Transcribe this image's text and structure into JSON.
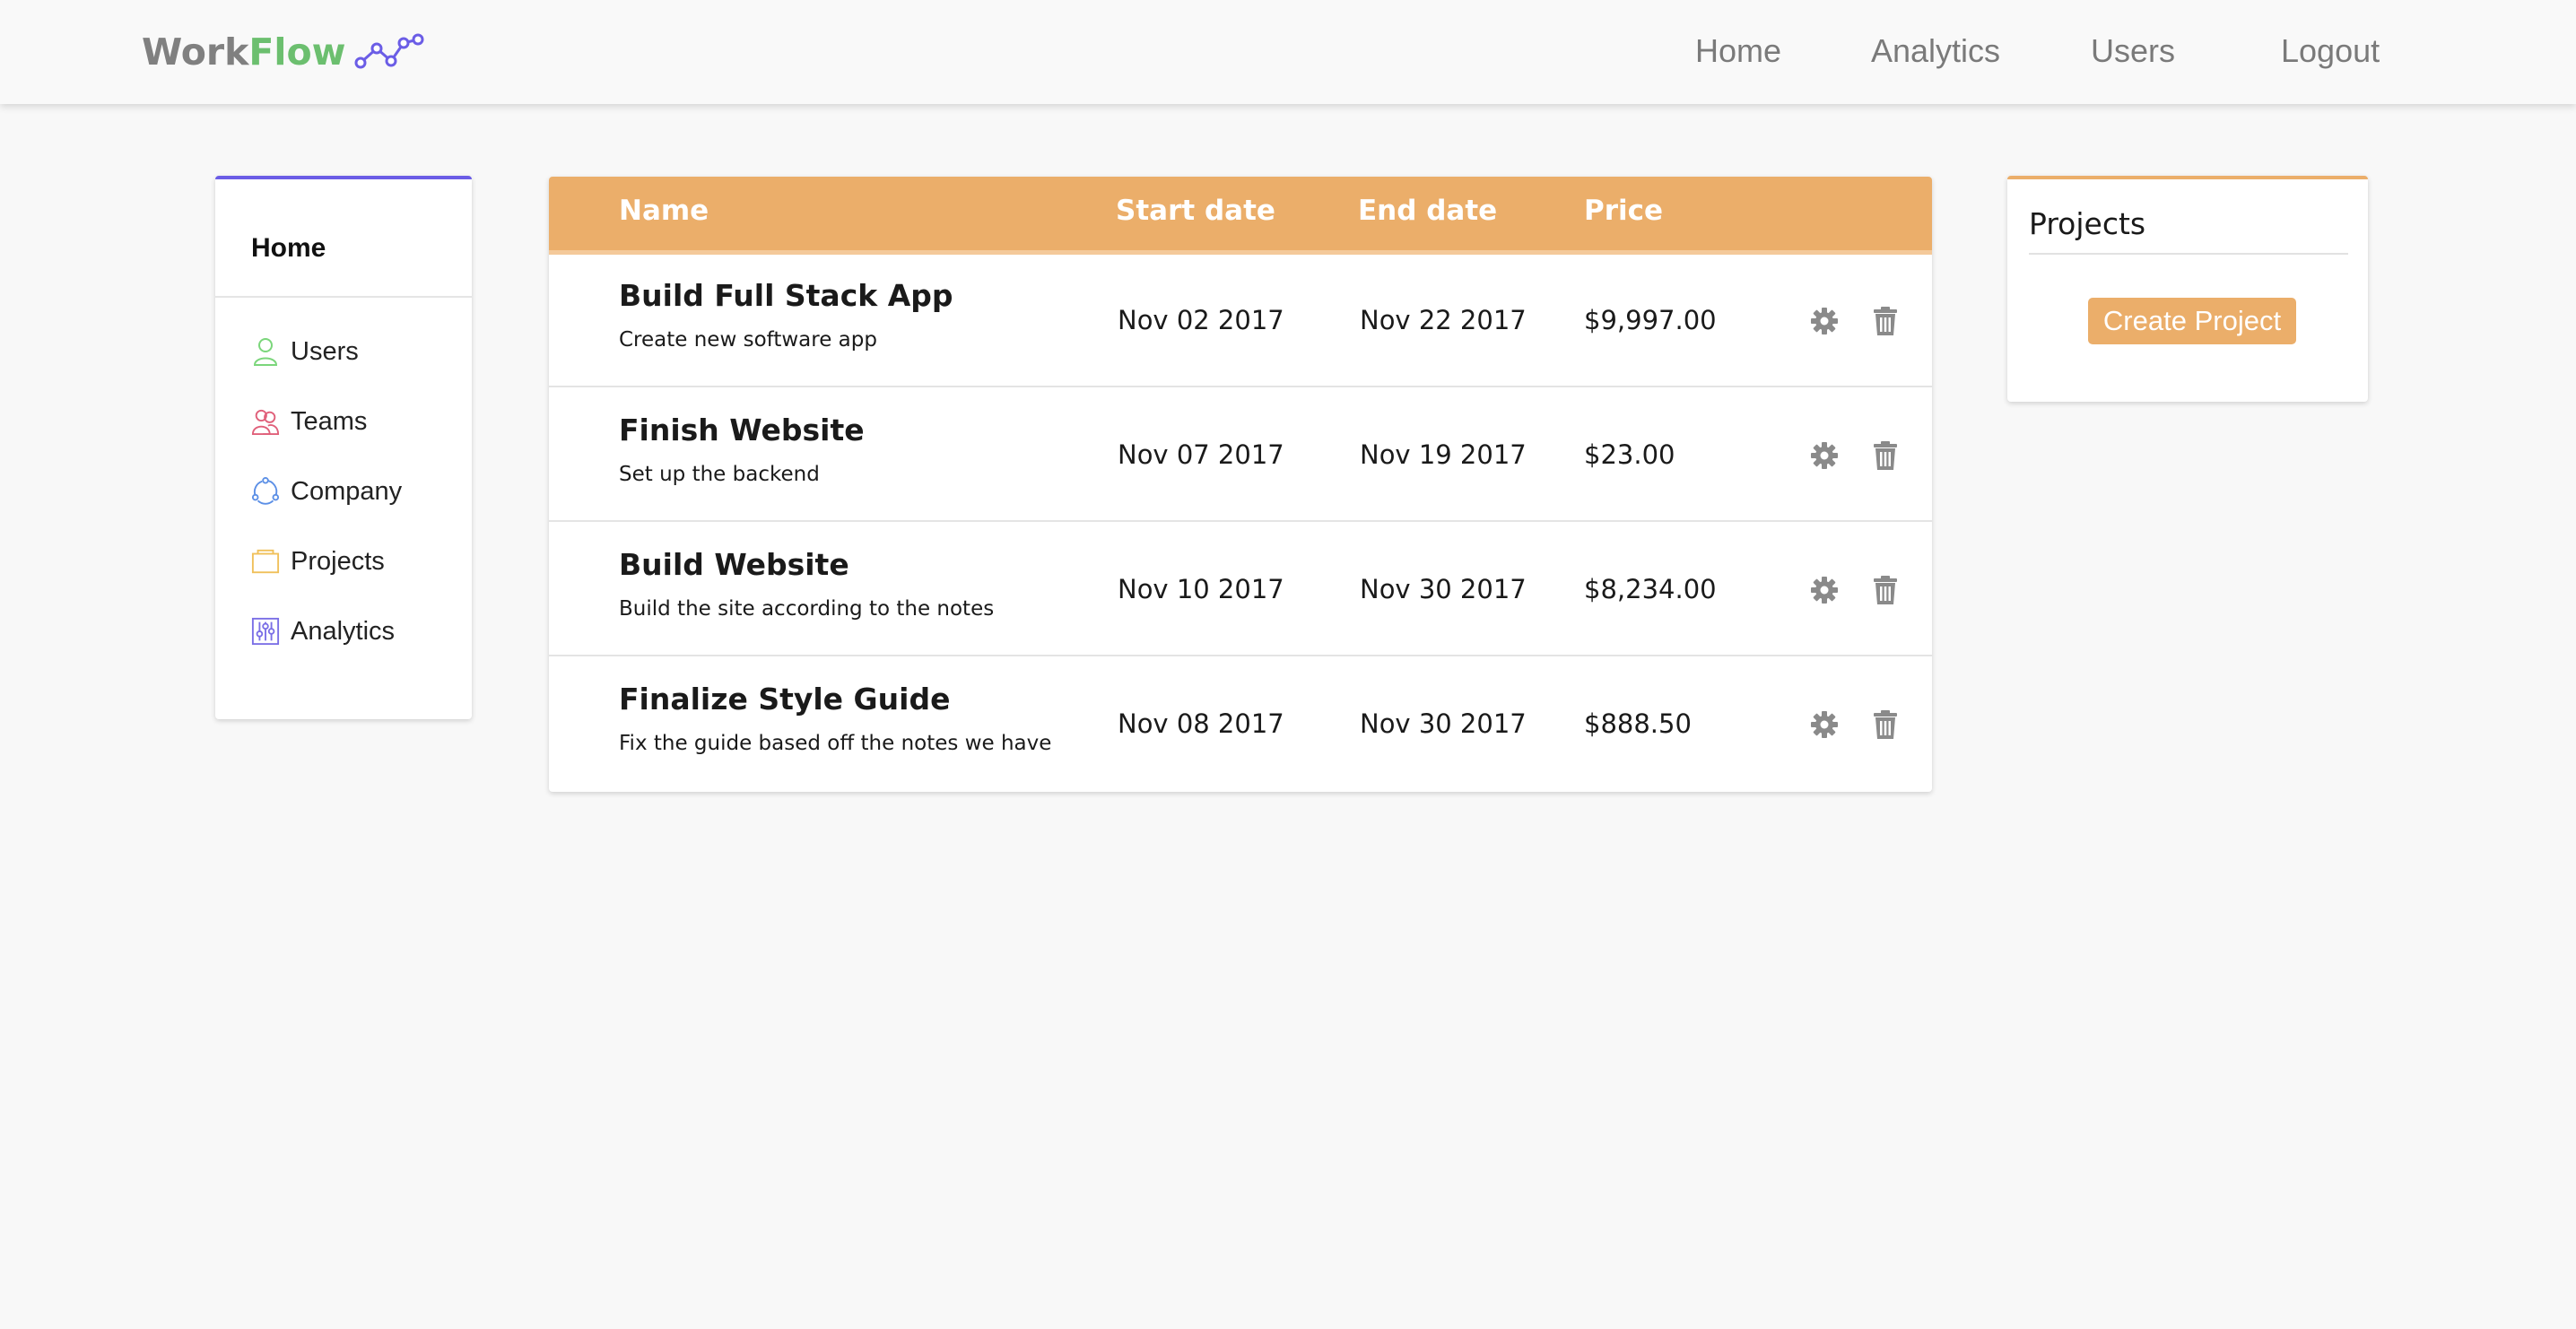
{
  "brand": {
    "part1": "Work",
    "part2": "Flow",
    "icon": "graph-line-icon"
  },
  "topnav": [
    "Home",
    "Analytics",
    "Users",
    "Logout"
  ],
  "sidebar": {
    "title": "Home",
    "items": [
      {
        "label": "Users",
        "icon": "user-icon",
        "color": "#7bd67b"
      },
      {
        "label": "Teams",
        "icon": "team-icon",
        "color": "#e0607a"
      },
      {
        "label": "Company",
        "icon": "company-icon",
        "color": "#5b8fe6"
      },
      {
        "label": "Projects",
        "icon": "folder-icon",
        "color": "#f0c05a"
      },
      {
        "label": "Analytics",
        "icon": "sliders-icon",
        "color": "#7b6fe6"
      }
    ]
  },
  "table": {
    "headers": [
      "Name",
      "Start date",
      "End date",
      "Price"
    ],
    "rows": [
      {
        "name": "Build Full Stack App",
        "desc": "Create new software app",
        "start": "Nov 02 2017",
        "end": "Nov 22 2017",
        "price": "$9,997.00"
      },
      {
        "name": "Finish Website",
        "desc": "Set up the backend",
        "start": "Nov 07 2017",
        "end": "Nov 19 2017",
        "price": "$23.00"
      },
      {
        "name": "Build Website",
        "desc": "Build the site according to the notes",
        "start": "Nov 10 2017",
        "end": "Nov 30 2017",
        "price": "$8,234.00"
      },
      {
        "name": "Finalize Style Guide",
        "desc": "Fix the guide based off the notes we have",
        "start": "Nov 08 2017",
        "end": "Nov 30 2017",
        "price": "$888.50"
      }
    ]
  },
  "projects_panel": {
    "title": "Projects",
    "button_label": "Create Project"
  },
  "colors": {
    "accent": "#ebae6a",
    "sidebar_accent": "#6b5de6",
    "brand_green": "#6cbf6f",
    "brand_gray": "#808080"
  }
}
